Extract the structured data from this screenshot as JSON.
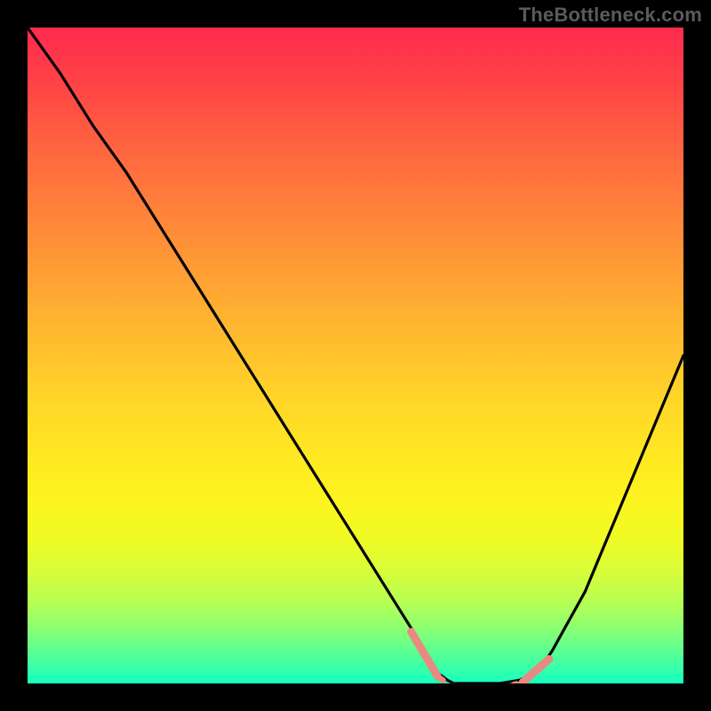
{
  "watermark": "TheBottleneck.com",
  "chart_data": {
    "type": "line",
    "title": "",
    "xlabel": "",
    "ylabel": "",
    "xlim": [
      0,
      100
    ],
    "ylim": [
      0,
      100
    ],
    "grid": false,
    "series": [
      {
        "name": "bottleneck-curve",
        "x": [
          0,
          5,
          10,
          15,
          20,
          25,
          30,
          35,
          40,
          45,
          50,
          55,
          60,
          62,
          64,
          65,
          68,
          72,
          75,
          78,
          80,
          85,
          90,
          95,
          100
        ],
        "y": [
          100,
          93,
          85,
          78,
          70,
          62,
          54,
          46,
          38,
          30,
          22,
          14,
          6,
          2,
          0.5,
          0,
          0,
          0,
          0.5,
          2,
          5,
          14,
          26,
          38,
          50
        ],
        "color": "#000000"
      }
    ],
    "annotations": [
      {
        "name": "optimal-range-markers",
        "type": "segment-pair",
        "x_start": 60,
        "x_end": 78,
        "color": "#e88a82"
      }
    ],
    "background_gradient": {
      "stops": [
        {
          "pos": 0,
          "color": "#ff2b4f"
        },
        {
          "pos": 20,
          "color": "#ff6a3f"
        },
        {
          "pos": 45,
          "color": "#ffb530"
        },
        {
          "pos": 65,
          "color": "#ffe722"
        },
        {
          "pos": 83,
          "color": "#d7fd3a"
        },
        {
          "pos": 100,
          "color": "#16ffbf"
        }
      ]
    }
  }
}
